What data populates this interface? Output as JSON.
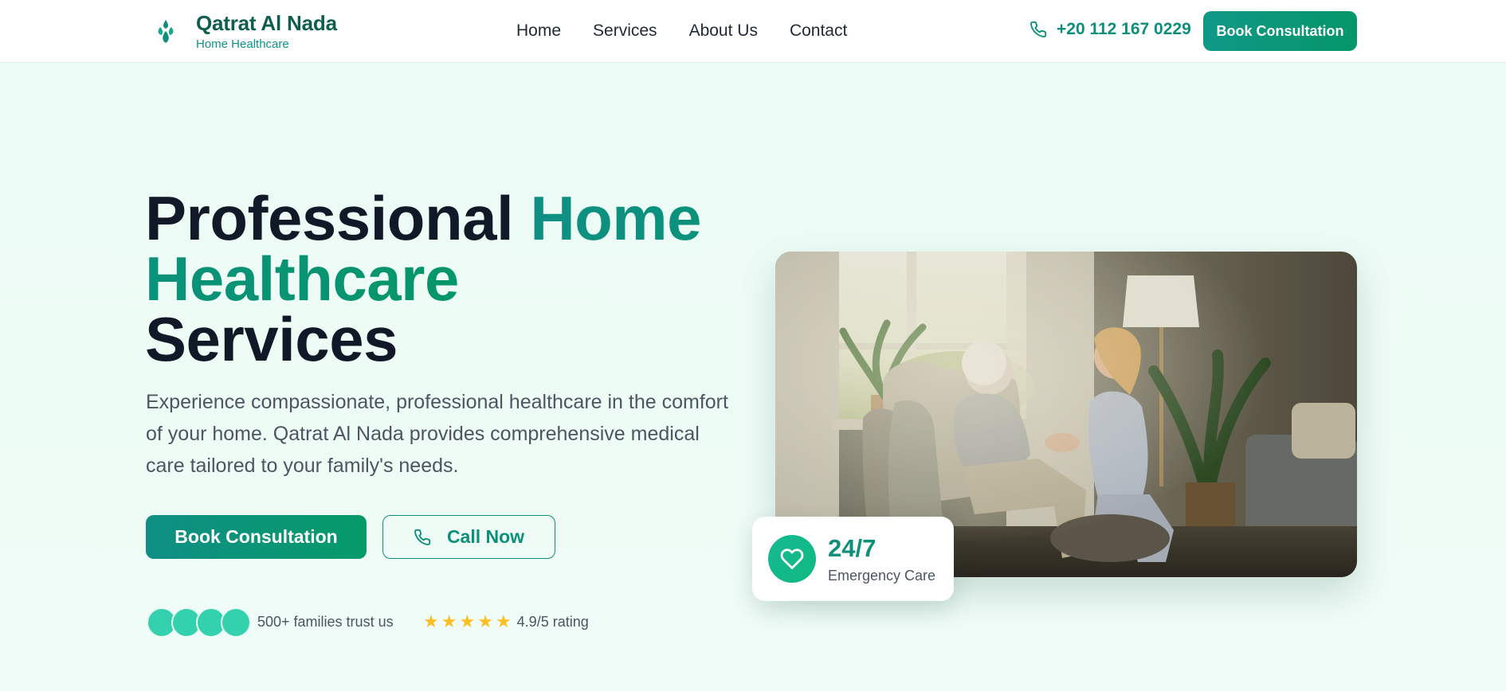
{
  "header": {
    "brand_name": "Qatrat Al Nada",
    "brand_tagline": "Home Healthcare",
    "logo_icon": "droplets-icon",
    "nav": [
      "Home",
      "Services",
      "About Us",
      "Contact"
    ],
    "phone": "+20 112 167 0229",
    "phone_icon": "phone-icon",
    "cta": "Book Consultation"
  },
  "hero": {
    "title_part1": "Professional",
    "title_accent": "Home Healthcare",
    "title_part2": "Services",
    "description": "Experience compassionate, professional healthcare in the comfort of your home. Qatrat Al Nada provides comprehensive medical care tailored to your family's needs.",
    "primary_cta": "Book Consultation",
    "secondary_cta": "Call Now",
    "trust_text": "500+ families trust us",
    "rating_stars": 5,
    "rating_text": "4.9/5 rating"
  },
  "badge": {
    "icon": "heart-icon",
    "title": "24/7",
    "subtitle": "Emergency Care"
  },
  "colors": {
    "brand_teal": "#0d8f7a",
    "brand_green": "#059669",
    "background": "#ecfbf5",
    "star": "#fbbf24"
  }
}
